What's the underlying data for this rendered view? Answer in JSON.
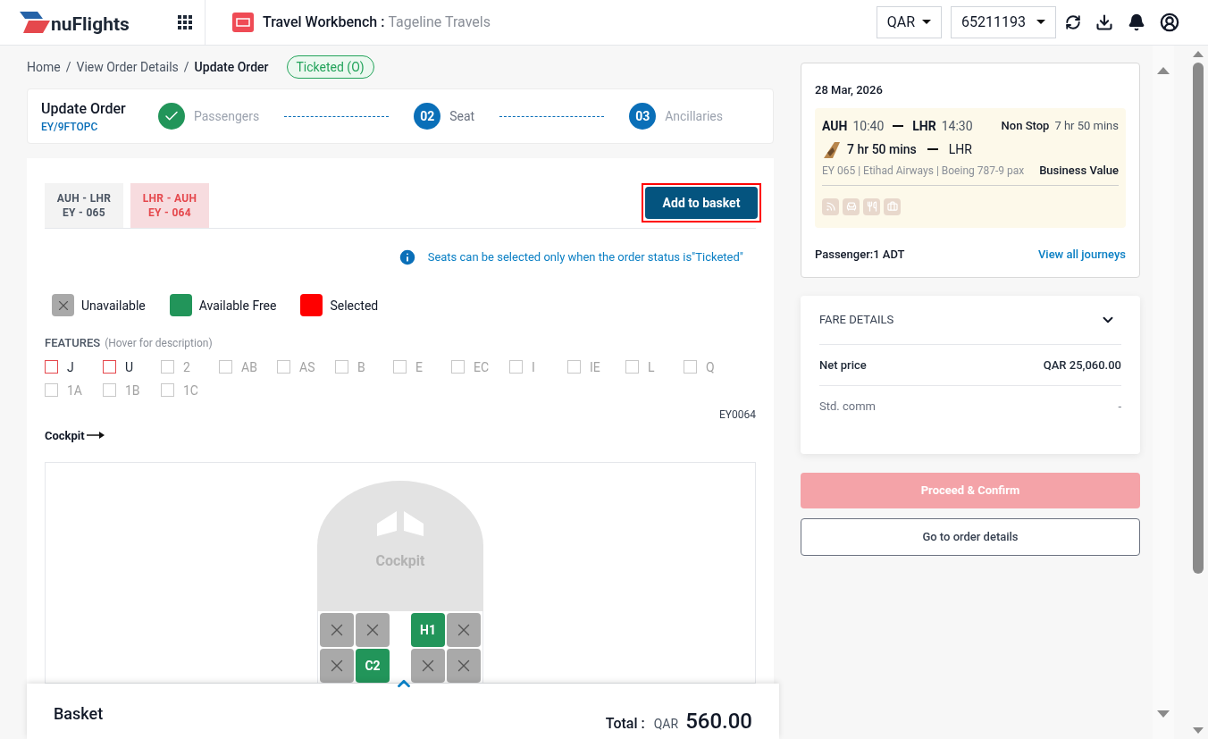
{
  "header": {
    "logo_text": "nuFlights",
    "app_title": "Travel Workbench :",
    "agency": "Tageline Travels",
    "currency": "QAR",
    "account": "65211193"
  },
  "breadcrumb": {
    "items": [
      "Home",
      "View Order Details"
    ],
    "separator": "/",
    "current": "Update Order",
    "status_badge": "Ticketed (O)"
  },
  "order": {
    "title": "Update Order",
    "ref": "EY/9FTOPC",
    "steps": [
      {
        "label": "Passengers",
        "completed": true,
        "selected": false
      },
      {
        "number": "02",
        "label": "Seat",
        "completed": false,
        "selected": true
      },
      {
        "number": "03",
        "label": "Ancillaries",
        "completed": false,
        "selected": false
      }
    ]
  },
  "segment_tabs": [
    {
      "route": "AUH - LHR",
      "flight": "EY - 065",
      "selected": false
    },
    {
      "route": "LHR - AUH",
      "flight": "EY - 064",
      "selected": true
    }
  ],
  "add_button": "Add to basket",
  "info_note": "Seats can be selected only when the order status is\"Ticketed\"",
  "legend": [
    {
      "kind": "unavailable",
      "label": "Unavailable"
    },
    {
      "kind": "available",
      "label": "Available Free"
    },
    {
      "kind": "selected",
      "label": "Selected"
    }
  ],
  "features": {
    "title": "FEATURES",
    "hint": "(Hover for description)",
    "items": [
      {
        "label": "J",
        "kind": "offered"
      },
      {
        "label": "U",
        "kind": "offered"
      },
      {
        "label": "2",
        "kind": "inactive"
      },
      {
        "label": "AB",
        "kind": "inactive"
      },
      {
        "label": "AS",
        "kind": "inactive"
      },
      {
        "label": "B",
        "kind": "inactive"
      },
      {
        "label": "E",
        "kind": "inactive"
      },
      {
        "label": "EC",
        "kind": "inactive"
      },
      {
        "label": "I",
        "kind": "inactive"
      },
      {
        "label": "IE",
        "kind": "inactive"
      },
      {
        "label": "L",
        "kind": "inactive"
      },
      {
        "label": "Q",
        "kind": "inactive"
      },
      {
        "label": "1A",
        "kind": "inactive"
      },
      {
        "label": "1B",
        "kind": "inactive"
      },
      {
        "label": "1C",
        "kind": "inactive"
      }
    ]
  },
  "aircraft_code": "EY0064",
  "cockpit_link": "Cockpit",
  "cockpit_label": "Cockpit",
  "seat_rows": [
    {
      "left": [
        {
          "kind": "unavailable"
        },
        {
          "kind": "unavailable"
        }
      ],
      "right": [
        {
          "kind": "available",
          "label": "H1"
        },
        {
          "kind": "unavailable"
        }
      ]
    },
    {
      "left": [
        {
          "kind": "unavailable"
        },
        {
          "kind": "available",
          "label": "C2"
        }
      ],
      "right": [
        {
          "kind": "unavailable"
        },
        {
          "kind": "unavailable"
        }
      ]
    }
  ],
  "basket": {
    "title": "Basket",
    "total_label": "Total :",
    "currency": "QAR",
    "amount": "560.00"
  },
  "journey": {
    "date": "28 Mar, 2026",
    "from": "AUH",
    "dep": "10:40",
    "to": "LHR",
    "arr": "14:30",
    "stops": "Non Stop",
    "duration": "7 hr 50 mins",
    "leg_duration": "7 hr 50 mins",
    "leg_to": "LHR",
    "details": "EY 065 | Etihad Airways | Boeing 787-9 pax",
    "cabin": "Business Value",
    "passenger": "Passenger:1 ADT",
    "view_all": "View all journeys"
  },
  "fare": {
    "title": "FARE DETAILS",
    "rows": [
      {
        "label": "Net price",
        "value": "QAR 25,060.00",
        "kind": "strong"
      },
      {
        "label": "Std. comm",
        "value": "-",
        "kind": "muted"
      }
    ]
  },
  "proceed_button": {
    "label": "Proceed & Confirm",
    "disabled": true
  },
  "order_details_button": "Go to order details"
}
